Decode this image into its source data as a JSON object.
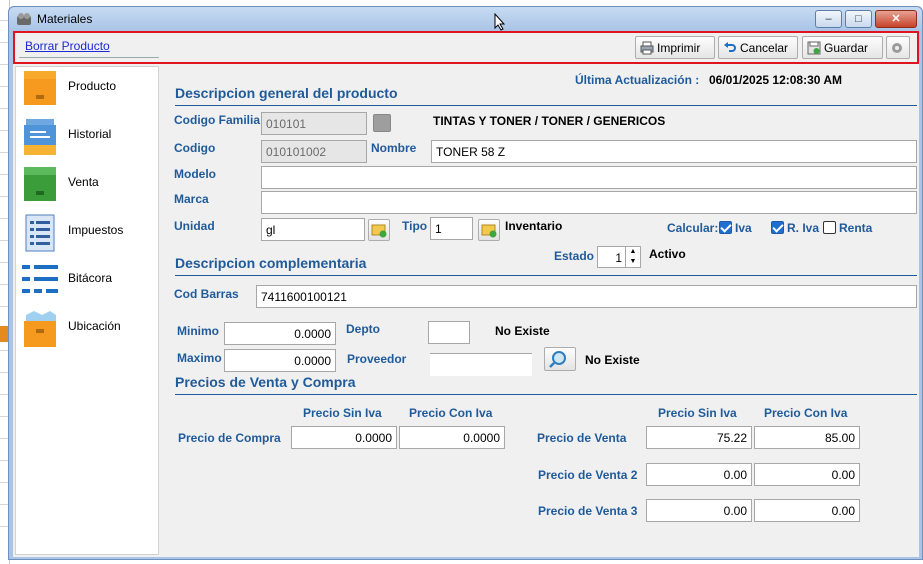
{
  "window": {
    "title": "Materiales"
  },
  "toolbar": {
    "delete_link": "Borrar Producto",
    "print_label": "Imprimir",
    "cancel_label": "Cancelar",
    "save_label": "Guardar"
  },
  "sidebar": {
    "items": [
      {
        "label": "Producto",
        "icon": "product-box-icon"
      },
      {
        "label": "Historial",
        "icon": "history-icon"
      },
      {
        "label": "Venta",
        "icon": "sale-box-icon"
      },
      {
        "label": "Impuestos",
        "icon": "tax-document-icon"
      },
      {
        "label": "Bitácora",
        "icon": "log-list-icon"
      },
      {
        "label": "Ubicación",
        "icon": "location-box-icon"
      }
    ]
  },
  "header": {
    "last_update_label": "Última Actualización :",
    "last_update_value": "06/01/2025 12:08:30 AM"
  },
  "general": {
    "title": "Descripcion general del producto",
    "family_label": "Codigo Familia",
    "family_value": "010101",
    "family_desc": "TINTAS Y TONER / TONER / GENERICOS",
    "code_label": "Codigo",
    "code_value": "010101002",
    "name_label": "Nombre",
    "name_value": "TONER 58 Z",
    "model_label": "Modelo",
    "model_value": "",
    "brand_label": "Marca",
    "brand_value": "",
    "unit_label": "Unidad",
    "unit_value": "gl",
    "type_label": "Tipo",
    "type_value": "1",
    "type_desc": "Inventario",
    "calc_label": "Calcular:",
    "iva_label": "Iva",
    "riva_label": "R. Iva",
    "renta_label": "Renta",
    "iva_checked": true,
    "riva_checked": true,
    "renta_checked": false
  },
  "complement": {
    "title": "Descripcion complementaria",
    "state_label": "Estado",
    "state_value": "1",
    "state_desc": "Activo",
    "barcode_label": "Cod Barras",
    "barcode_value": "7411600100121",
    "min_label": "Minimo",
    "min_value": "0.0000",
    "max_label": "Maximo",
    "max_value": "0.0000",
    "dept_label": "Depto",
    "dept_value": "",
    "dept_status": "No Existe",
    "supplier_label": "Proveedor",
    "supplier_value": "",
    "supplier_status": "No Existe"
  },
  "prices": {
    "title": "Precios de Venta y Compra",
    "col_no_iva": "Precio Sin Iva",
    "col_with_iva": "Precio Con Iva",
    "purchase_label": "Precio de Compra",
    "purchase_no_iva": "0.0000",
    "purchase_with_iva": "0.0000",
    "sale_col_no_iva": "Precio Sin Iva",
    "sale_col_with_iva": "Precio Con Iva",
    "sale_rows": [
      {
        "label": "Precio de Venta",
        "no_iva": "75.22",
        "with_iva": "85.00"
      },
      {
        "label": "Precio de Venta 2",
        "no_iva": "0.00",
        "with_iva": "0.00"
      },
      {
        "label": "Precio de Venta 3",
        "no_iva": "0.00",
        "with_iva": "0.00"
      }
    ]
  },
  "colors": {
    "accent": "#1f5a9a",
    "highlight_border": "#e0141e",
    "link": "#1a2bd1"
  }
}
